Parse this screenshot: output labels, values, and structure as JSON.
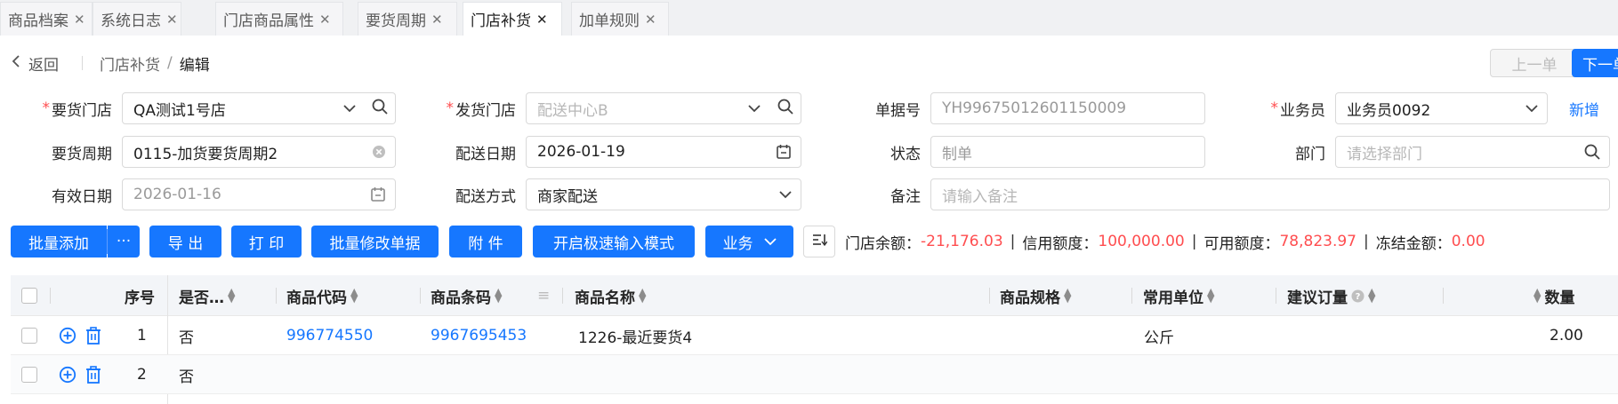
{
  "tabs": [
    {
      "label": "商品档案",
      "active": false
    },
    {
      "label": "系统日志",
      "active": false
    },
    {
      "label": "门店商品属性",
      "active": false
    },
    {
      "label": "要货周期",
      "active": false
    },
    {
      "label": "门店补货",
      "active": true
    },
    {
      "label": "加单规则",
      "active": false
    }
  ],
  "header": {
    "back_label": "返回",
    "breadcrumb_parent": "门店补货",
    "breadcrumb_sep": "/",
    "breadcrumb_current": "编辑",
    "prev_label": "上一单",
    "next_label": "下一单"
  },
  "form": {
    "req_store": {
      "label": "要货门店",
      "value": "QA测试1号店"
    },
    "ship_store": {
      "label": "发货门店",
      "placeholder": "配送中心B"
    },
    "doc_no": {
      "label": "单据号",
      "value": "YH99675012601150009"
    },
    "salesman": {
      "label": "业务员",
      "value": "业务员0092",
      "new_label": "新增"
    },
    "cycle": {
      "label": "要货周期",
      "value": "0115-加货要货周期2"
    },
    "delivery_date": {
      "label": "配送日期",
      "value": "2026-01-19"
    },
    "status": {
      "label": "状态",
      "value": "制单"
    },
    "dept": {
      "label": "部门",
      "placeholder": "请选择部门"
    },
    "valid_date": {
      "label": "有效日期",
      "value": "2026-01-16"
    },
    "delivery_method": {
      "label": "配送方式",
      "value": "商家配送"
    },
    "remark": {
      "label": "备注",
      "placeholder": "请输入备注"
    }
  },
  "toolbar": {
    "batch_add": "批量添加",
    "more": "···",
    "export": "导 出",
    "print": "打 印",
    "batch_edit": "批量修改单据",
    "attach": "附 件",
    "fast_input": "开启极速输入模式",
    "business": "业务"
  },
  "balance": {
    "store_label": "门店余额：",
    "store_value": "-21,176.03",
    "credit_label": "信用额度：",
    "credit_value": "100,000.00",
    "avail_label": "可用额度：",
    "avail_value": "78,823.97",
    "frozen_label": "冻结金额：",
    "frozen_value": "0.00",
    "sep": "|"
  },
  "table": {
    "headers": {
      "seq": "序号",
      "flag": "是否…",
      "code": "商品代码",
      "barcode": "商品条码",
      "name": "商品名称",
      "spec": "商品规格",
      "unit": "常用单位",
      "suggest": "建议订量",
      "qty": "数量"
    },
    "rows": [
      {
        "seq": "1",
        "flag": "否",
        "code": "996774550",
        "barcode": "9967695453",
        "name": "1226-最近要货4",
        "unit": "公斤",
        "qty": "2.00"
      },
      {
        "seq": "2",
        "flag": "否",
        "code": "",
        "barcode": "",
        "name": "",
        "unit": "",
        "qty": ""
      }
    ]
  },
  "colors": {
    "primary": "#1677ff",
    "danger": "#ff4d4f"
  }
}
